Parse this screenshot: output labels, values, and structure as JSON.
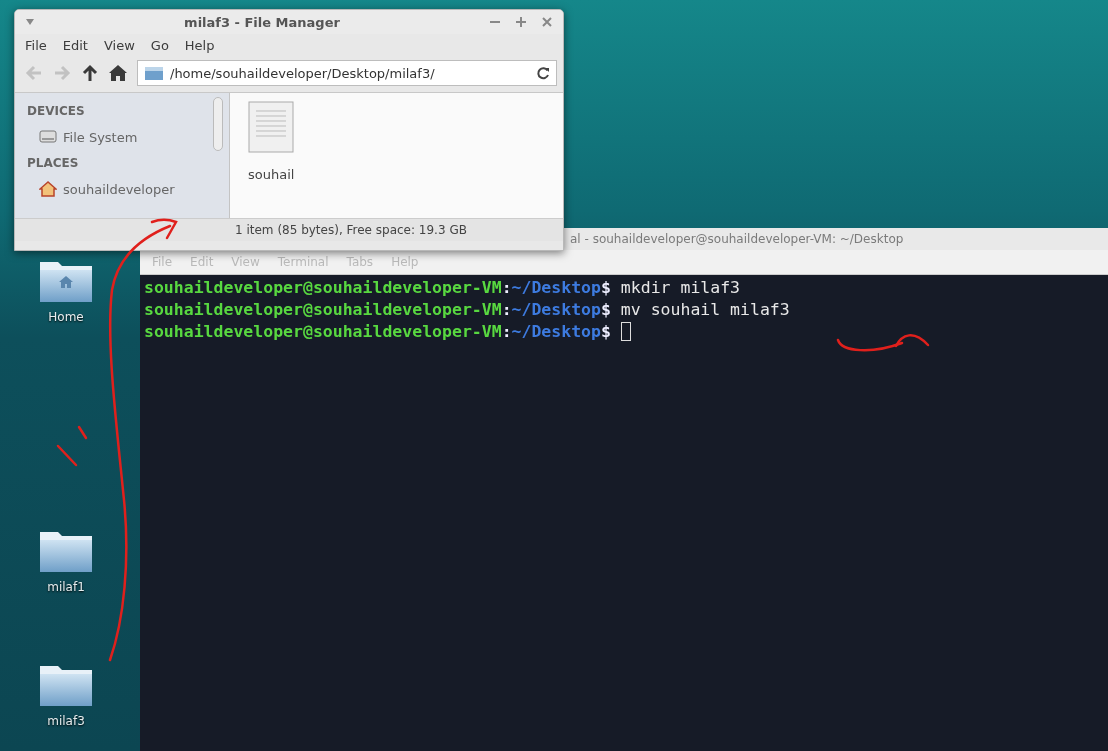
{
  "desktop": {
    "icons": [
      {
        "label": "Home",
        "kind": "home"
      },
      {
        "label": "milaf1",
        "kind": "folder"
      },
      {
        "label": "milaf3",
        "kind": "folder"
      }
    ]
  },
  "file_manager": {
    "title": "milaf3 - File Manager",
    "menu": [
      "File",
      "Edit",
      "View",
      "Go",
      "Help"
    ],
    "nav": [
      {
        "kind": "back",
        "disabled": true
      },
      {
        "kind": "forward",
        "disabled": true
      },
      {
        "kind": "up",
        "disabled": false
      },
      {
        "kind": "home",
        "disabled": false
      }
    ],
    "location": "/home/souhaildeveloper/Desktop/milaf3/",
    "sidebar": [
      {
        "heading": "DEVICES",
        "items": [
          {
            "label": "File System",
            "kind": "drive"
          }
        ]
      },
      {
        "heading": "PLACES",
        "items": [
          {
            "label": "souhaildeveloper",
            "kind": "home"
          }
        ]
      }
    ],
    "files": [
      {
        "name": "souhail"
      }
    ],
    "status": "1 item (85 bytes), Free space: 19.3 GB"
  },
  "terminal": {
    "title": "al - souhaildeveloper@souhaildeveloper-VM: ~/Desktop",
    "menu": [
      "File",
      "Edit",
      "View",
      "Terminal",
      "Tabs",
      "Help"
    ],
    "lines": [
      {
        "user": "souhaildeveloper@souhaildeveloper-VM",
        "separator": ":",
        "path": "~/Desktop",
        "prompt": "$",
        "command": "mkdir milaf3",
        "cursor": false
      },
      {
        "user": "souhaildeveloper@souhaildeveloper-VM",
        "separator": ":",
        "path": "~/Desktop",
        "prompt": "$",
        "command": "mv souhail milaf3",
        "cursor": false
      },
      {
        "user": "souhaildeveloper@souhaildeveloper-VM",
        "separator": ":",
        "path": "~/Desktop",
        "prompt": "$",
        "cursor": true
      }
    ]
  }
}
